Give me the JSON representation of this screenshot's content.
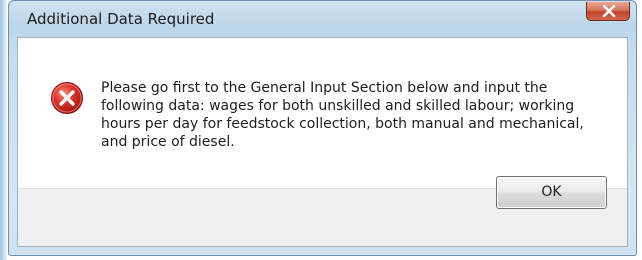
{
  "dialog": {
    "title": "Additional Data Required",
    "message": "Please go first to the General Input Section below and input the\nfollowing data: wages for both unskilled and skilled labour; working\nhours per day for feedstock collection, both manual and mechanical,\nand price of diesel.",
    "icon": "error-icon",
    "ok_label": "OK",
    "close_icon": "close-icon"
  },
  "colors": {
    "error_red": "#d92b2b",
    "close_button_red": "#c3452c",
    "frame_blue": "#bcd6ea"
  }
}
